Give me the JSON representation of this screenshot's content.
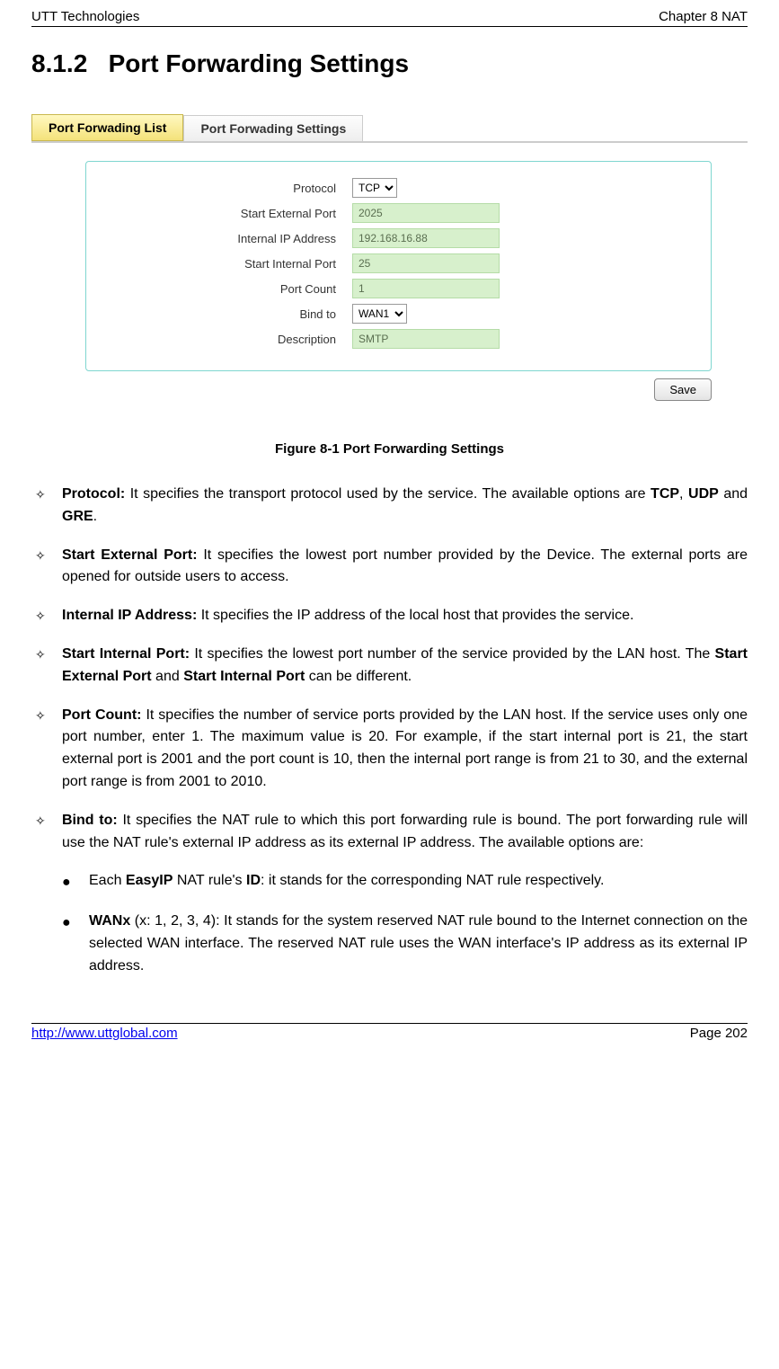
{
  "header": {
    "left": "UTT Technologies",
    "right": "Chapter 8 NAT"
  },
  "section_number": "8.1.2",
  "section_title": "Port Forwarding Settings",
  "tabs": {
    "list": "Port Forwading List",
    "settings": "Port Forwading Settings"
  },
  "form": {
    "protocol_label": "Protocol",
    "protocol_value": "TCP",
    "start_ext_label": "Start External Port",
    "start_ext_value": "2025",
    "internal_ip_label": "Internal IP Address",
    "internal_ip_value": "192.168.16.88",
    "start_int_label": "Start Internal Port",
    "start_int_value": "25",
    "port_count_label": "Port Count",
    "port_count_value": "1",
    "bind_label": "Bind to",
    "bind_value": "WAN1",
    "desc_label": "Description",
    "desc_value": "SMTP",
    "save": "Save"
  },
  "figure_caption": "Figure 8-1 Port Forwarding Settings",
  "content": {
    "protocol_b": "Protocol:",
    "protocol_t1": " It specifies the transport protocol used by the service. The available options are ",
    "protocol_tcp": "TCP",
    "protocol_c1": ", ",
    "protocol_udp": "UDP",
    "protocol_and": " and ",
    "protocol_gre": "GRE",
    "protocol_dot": ".",
    "startext_b": "Start External Port:",
    "startext_t": " It specifies the lowest port number provided by the Device. The external ports are opened for outside users to access.",
    "intip_b": "Internal IP Address:",
    "intip_t": " It specifies the IP address of the local host that provides the service.",
    "startint_b": "Start Internal Port:",
    "startint_t1": " It specifies the lowest port number of the service provided by the LAN host. The ",
    "startint_sep": "Start External Port",
    "startint_and": " and ",
    "startint_sip": "Start Internal Port",
    "startint_t2": " can be different.",
    "portcount_b": "Port Count:",
    "portcount_t": " It specifies the number of service ports provided by the LAN host. If the service uses only one port number, enter 1. The maximum value is 20. For example, if the start internal port is 21, the start external port is 2001 and the port count is 10, then the internal port range is from 21 to 30, and the external port range is from 2001 to 2010.",
    "bind_b": "Bind to:",
    "bind_t": " It specifies the NAT rule to which this port forwarding rule is bound. The port forwarding rule will use the NAT rule's external IP address as its external IP address. The available options are:",
    "sub1_t1": "Each ",
    "sub1_easyip": "EasyIP",
    "sub1_t2": " NAT rule's ",
    "sub1_id": "ID",
    "sub1_t3": ": it stands for the corresponding NAT rule respectively.",
    "sub2_wanx": "WANx",
    "sub2_t": " (x: 1, 2, 3, 4): It stands for the system reserved NAT rule bound to the Internet connection on the selected WAN interface. The reserved NAT rule uses the WAN interface's IP address as its external IP address."
  },
  "footer": {
    "url": "http://www.uttglobal.com",
    "page": "Page 202"
  }
}
